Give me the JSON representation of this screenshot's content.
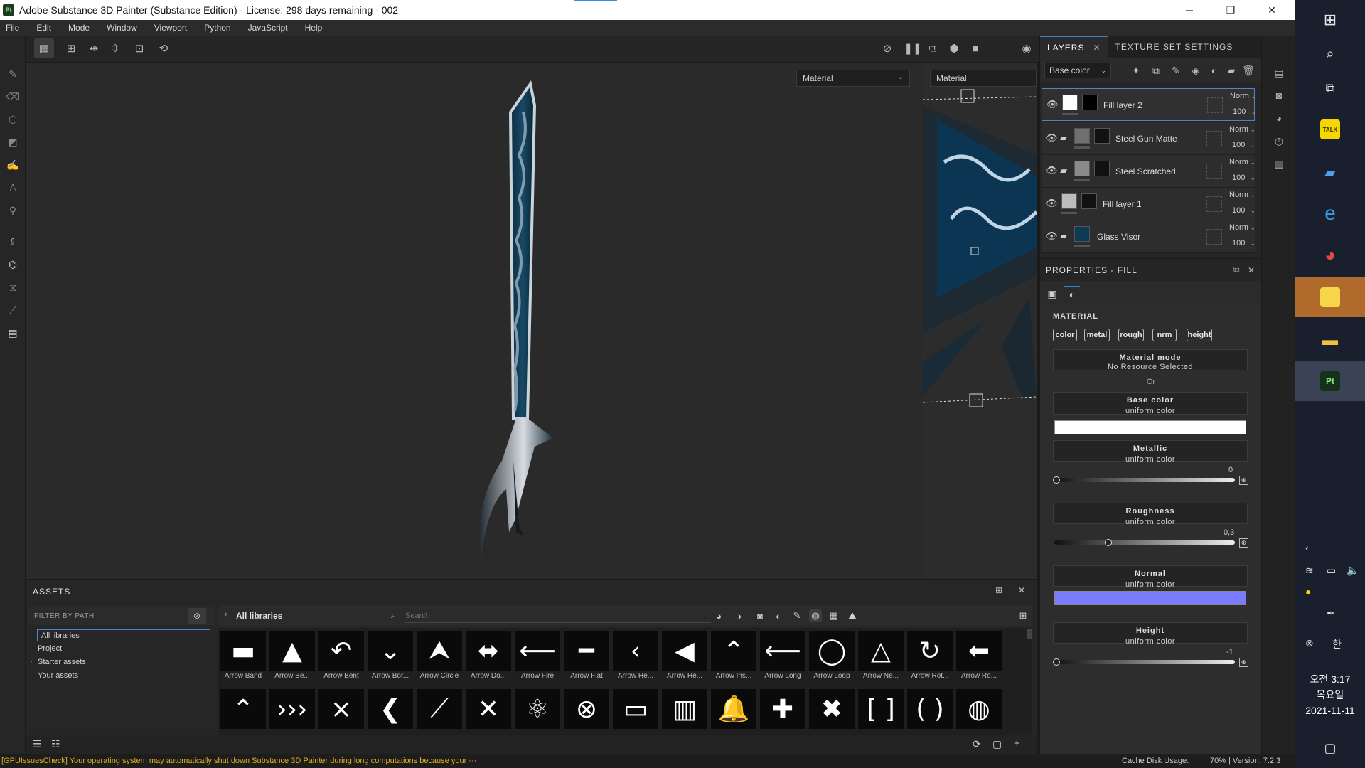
{
  "window": {
    "title": "Adobe Substance 3D Painter (Substance Edition) - License: 298 days remaining - 002",
    "app_badge": "Pt",
    "minimize": "─",
    "maximize": "❐",
    "close": "✕"
  },
  "menu": [
    "File",
    "Edit",
    "Mode",
    "Window",
    "Viewport",
    "Python",
    "JavaScript",
    "Help"
  ],
  "viewport": {
    "left_select": "Material",
    "right_select": "Material"
  },
  "layers_panel": {
    "tabs": [
      "LAYERS",
      "TEXTURE SET SETTINGS"
    ],
    "channel_select": "Base color",
    "layers": [
      {
        "name": "Fill layer 2",
        "blend": "Norm",
        "opacity": "100",
        "type": "fill",
        "selected": true,
        "thumb_color": "#ffffff",
        "mask_color": "#000000"
      },
      {
        "name": "Steel Gun Matte",
        "blend": "Norm",
        "opacity": "100",
        "type": "folder",
        "selected": false,
        "thumb_color": "#6f6f6f",
        "mask_color": "#111111"
      },
      {
        "name": "Steel Scratched",
        "blend": "Norm",
        "opacity": "100",
        "type": "folder",
        "selected": false,
        "thumb_color": "#8a8a8a",
        "mask_color": "#111111"
      },
      {
        "name": "Fill layer 1",
        "blend": "Norm",
        "opacity": "100",
        "type": "fill",
        "selected": false,
        "thumb_color": "#bdbdbd",
        "mask_color": "#111111"
      },
      {
        "name": "Glass Visor",
        "blend": "Norm",
        "opacity": "100",
        "type": "folder",
        "selected": false,
        "thumb_color": "#0d3a55",
        "mask_color": ""
      }
    ]
  },
  "properties": {
    "title": "PROPERTIES - FILL",
    "section": "MATERIAL",
    "channels": [
      "color",
      "metal",
      "rough",
      "nrm",
      "height"
    ],
    "material_mode": {
      "title": "Material mode",
      "sub": "No Resource Selected"
    },
    "or_label": "Or",
    "base_color": {
      "title": "Base color",
      "sub": "uniform color",
      "color": "#ffffff"
    },
    "metallic": {
      "title": "Metallic",
      "sub": "uniform color",
      "value": "0",
      "fraction": 0
    },
    "roughness": {
      "title": "Roughness",
      "sub": "uniform color",
      "value": "0,3",
      "fraction": 0.3
    },
    "normal": {
      "title": "Normal",
      "sub": "uniform color",
      "color": "#7b7bff"
    },
    "height": {
      "title": "Height",
      "sub": "uniform color",
      "value": "-1",
      "fraction": 0
    }
  },
  "assets": {
    "title": "ASSETS",
    "filter_placeholder": "FILTER BY PATH",
    "libraries": [
      "All libraries",
      "Project",
      "Starter assets",
      "Your assets"
    ],
    "breadcrumb": "All libraries",
    "search_placeholder": "Search",
    "row1": [
      {
        "label": "Arrow Band",
        "glyph": "▬"
      },
      {
        "label": "Arrow Be...",
        "glyph": "▲"
      },
      {
        "label": "Arrow Bent",
        "glyph": "↶"
      },
      {
        "label": "Arrow Bor...",
        "glyph": "⌄"
      },
      {
        "label": "Arrow Circle",
        "glyph": "⮝"
      },
      {
        "label": "Arrow Do...",
        "glyph": "⬌"
      },
      {
        "label": "Arrow Fire",
        "glyph": "⟵"
      },
      {
        "label": "Arrow Flat",
        "glyph": "━"
      },
      {
        "label": "Arrow He...",
        "glyph": "‹"
      },
      {
        "label": "Arrow He...",
        "glyph": "◀"
      },
      {
        "label": "Arrow Ins...",
        "glyph": "⌃"
      },
      {
        "label": "Arrow Long",
        "glyph": "⟵"
      },
      {
        "label": "Arrow Loop",
        "glyph": "◯"
      },
      {
        "label": "Arrow Ne...",
        "glyph": "△"
      },
      {
        "label": "Arrow Rot...",
        "glyph": "↻"
      },
      {
        "label": "Arrow Ro...",
        "glyph": "⬅"
      }
    ],
    "row2": [
      {
        "label": "",
        "glyph": "⌃"
      },
      {
        "label": "",
        "glyph": "›››"
      },
      {
        "label": "",
        "glyph": "⨯"
      },
      {
        "label": "",
        "glyph": "❮"
      },
      {
        "label": "",
        "glyph": "⟋"
      },
      {
        "label": "",
        "glyph": "✕"
      },
      {
        "label": "",
        "glyph": "⚛"
      },
      {
        "label": "",
        "glyph": "⊗"
      },
      {
        "label": "",
        "glyph": "▭"
      },
      {
        "label": "",
        "glyph": "▥"
      },
      {
        "label": "",
        "glyph": "🔔"
      },
      {
        "label": "",
        "glyph": "✚"
      },
      {
        "label": "",
        "glyph": "✖"
      },
      {
        "label": "",
        "glyph": "[ ]"
      },
      {
        "label": "",
        "glyph": "( )"
      },
      {
        "label": "",
        "glyph": "◍"
      }
    ]
  },
  "status": {
    "message": "[GPUIssuesCheck] Your operating system may automatically shut down Substance 3D Painter during long computations because your ···",
    "cache": "Cache Disk Usage:",
    "cache_value": "70%",
    "version": "| Version: 7.2.3"
  },
  "taskbar": {
    "clock_time": "오전 3:17",
    "clock_day": "목요일",
    "clock_date": "2021-11-11",
    "ime": "한",
    "kakao": "TALK",
    "pt": "Pt"
  }
}
